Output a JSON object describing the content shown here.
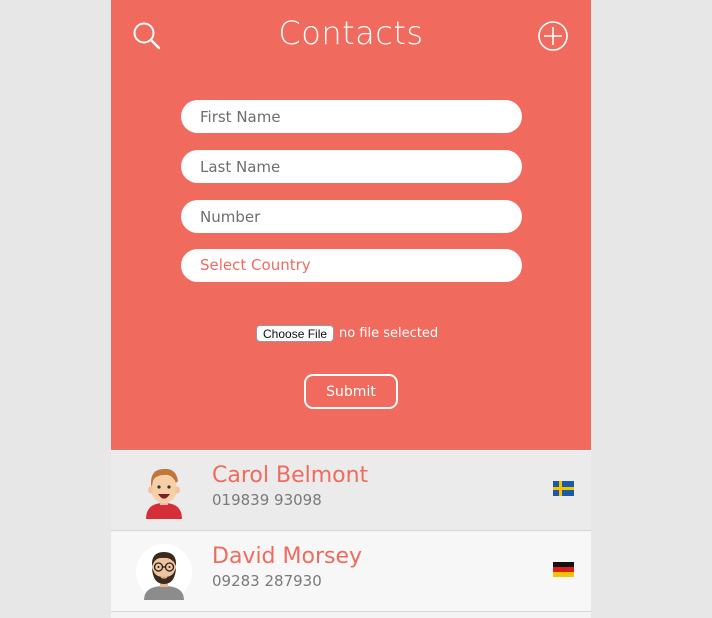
{
  "header": {
    "title": "Contacts",
    "search_icon": "search-icon",
    "add_icon": "plus-circle-icon"
  },
  "form": {
    "first_name_placeholder": "First Name",
    "last_name_placeholder": "Last Name",
    "number_placeholder": "Number",
    "country_select_label": "Select Country",
    "file_button_label": "Choose File",
    "file_status": "no file selected",
    "submit_label": "Submit"
  },
  "contacts": [
    {
      "name": "Carol Belmont",
      "number": "019839 93098",
      "country_flag": "sweden-flag-icon",
      "avatar": "avatar-red-shirt-icon"
    },
    {
      "name": "David Morsey",
      "number": "09283 287930",
      "country_flag": "germany-flag-icon",
      "avatar": "avatar-bearded-glasses-icon"
    }
  ],
  "colors": {
    "accent": "#f06b5e",
    "panel_text": "#ffffff",
    "name_text": "#f06b5e",
    "number_text": "#7a7a7a"
  }
}
